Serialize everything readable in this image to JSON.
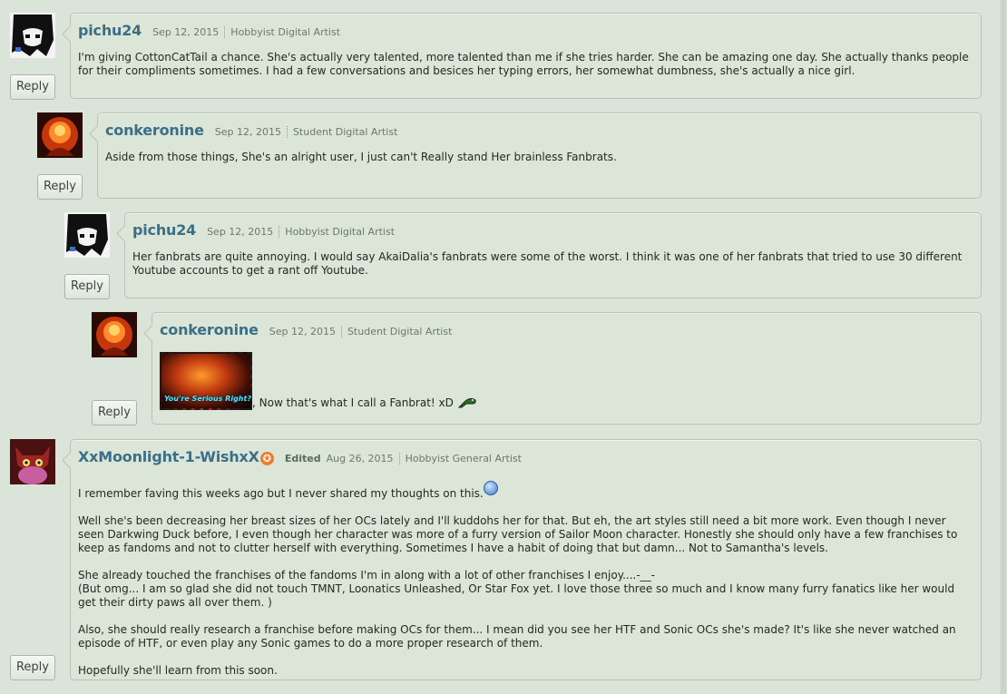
{
  "comments": [
    {
      "username": "pichu24",
      "date": "Sep 12, 2015",
      "role": "Hobbyist Digital Artist",
      "reply_label": "Reply",
      "paragraphs": [
        "I'm giving CottonCatTail a chance. She's actually very talented, more talented than me if she tries harder. She can be amazing one day. She actually thanks people for their compliments sometimes. I had a few conversations and besices her typing errors, her somewhat dumbness, she's actually a nice girl."
      ]
    },
    {
      "username": "conkeronine",
      "date": "Sep 12, 2015",
      "role": "Student Digital Artist",
      "reply_label": "Reply",
      "paragraphs": [
        "Aside from those things, She's an alright user, I just can't Really stand Her brainless Fanbrats."
      ]
    },
    {
      "username": "pichu24",
      "date": "Sep 12, 2015",
      "role": "Hobbyist Digital Artist",
      "reply_label": "Reply",
      "paragraphs": [
        "Her fanbrats are quite annoying. I would say AkaiDalia's fanbrats were some of the worst. I think it was one of her fanbrats that tried to use 30 different Youtube accounts to get a rant off Youtube."
      ]
    },
    {
      "username": "conkeronine",
      "date": "Sep 12, 2015",
      "role": "Student Digital Artist",
      "reply_label": "Reply",
      "image_caption": "You're Serious Right?",
      "text_after_image": ", Now that's what I call a Fanbrat! xD"
    },
    {
      "username": "XxMoonlight-1-WishxX",
      "edited_label": "Edited",
      "date": "Aug 26, 2015",
      "role": "Hobbyist General Artist",
      "reply_label": "Reply",
      "paragraphs": [
        "I remember faving this weeks ago but I never shared my thoughts on this.",
        "Well she's been decreasing her breast sizes of her OCs lately and I'll kuddohs her for that. But eh, the art styles still need a bit more work. Even though I never seen Darkwing Duck before, I even though her character was more of a furry version of Sailor Moon character. Honestly she should only have a few franchises to keep as fandoms and not to clutter herself with everything. Sometimes I have a habit of doing that but damn... Not to Samantha's levels.",
        "She already touched the franchises of the fandoms I'm in along with a lot of other franchises I enjoy....-__-",
        "(But omg... I am so glad she did not touch TMNT, Loonatics Unleashed, Or Star Fox yet. I love those three so much and I know many furry fanatics like her would get their dirty paws all over them. )",
        "Also, she should really research a franchise before making OCs for them... I mean did you see her HTF and Sonic OCs she's made? It's like she never watched an episode of HTF, or even play any Sonic games to do a more proper research of them.",
        "Hopefully she'll learn from this soon."
      ]
    }
  ],
  "colors": {
    "username": "#3b6f86",
    "background": "#dae4d8",
    "badge": "#ef7b2c"
  }
}
